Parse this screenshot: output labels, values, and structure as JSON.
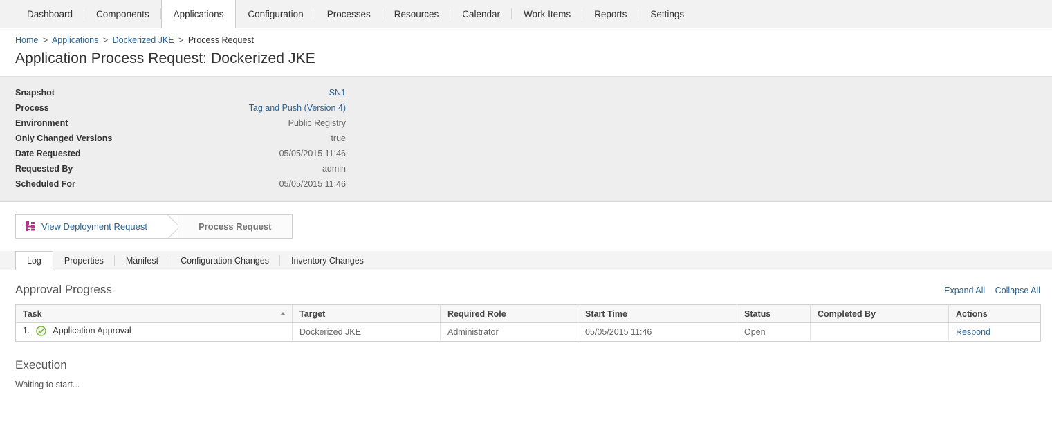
{
  "topnav": {
    "items": [
      {
        "label": "Dashboard",
        "active": false
      },
      {
        "label": "Components",
        "active": false
      },
      {
        "label": "Applications",
        "active": true
      },
      {
        "label": "Configuration",
        "active": false
      },
      {
        "label": "Processes",
        "active": false
      },
      {
        "label": "Resources",
        "active": false
      },
      {
        "label": "Calendar",
        "active": false
      },
      {
        "label": "Work Items",
        "active": false
      },
      {
        "label": "Reports",
        "active": false
      },
      {
        "label": "Settings",
        "active": false
      }
    ]
  },
  "breadcrumb": {
    "items": [
      {
        "label": "Home",
        "link": true
      },
      {
        "label": "Applications",
        "link": true
      },
      {
        "label": "Dockerized JKE",
        "link": true
      },
      {
        "label": "Process Request",
        "link": false
      }
    ],
    "separator": ">"
  },
  "page": {
    "title": "Application Process Request: Dockerized JKE"
  },
  "details": [
    {
      "label": "Snapshot",
      "value": "SN1",
      "link": true
    },
    {
      "label": "Process",
      "value": "Tag and Push (Version 4)",
      "link": true
    },
    {
      "label": "Environment",
      "value": "Public Registry",
      "link": false
    },
    {
      "label": "Only Changed Versions",
      "value": "true",
      "link": false
    },
    {
      "label": "Date Requested",
      "value": "05/05/2015 11:46",
      "link": false
    },
    {
      "label": "Requested By",
      "value": "admin",
      "link": false
    },
    {
      "label": "Scheduled For",
      "value": "05/05/2015 11:46",
      "link": false
    }
  ],
  "segmented": {
    "first_label": "View Deployment Request",
    "first_icon": "tree-branch-icon",
    "second_label": "Process Request"
  },
  "subtabs": {
    "items": [
      {
        "label": "Log",
        "active": true
      },
      {
        "label": "Properties",
        "active": false
      },
      {
        "label": "Manifest",
        "active": false
      },
      {
        "label": "Configuration Changes",
        "active": false
      },
      {
        "label": "Inventory Changes",
        "active": false
      }
    ]
  },
  "approval": {
    "title": "Approval Progress",
    "expand_all": "Expand All",
    "collapse_all": "Collapse All",
    "columns": [
      "Task",
      "Target",
      "Required Role",
      "Start Time",
      "Status",
      "Completed By",
      "Actions"
    ],
    "sorted_column": "Task",
    "sort_direction": "asc",
    "rows": [
      {
        "number": "1.",
        "icon": "green-check-circle-icon",
        "task": "Application Approval",
        "target": "Dockerized JKE",
        "required_role": "Administrator",
        "start_time": "05/05/2015 11:46",
        "status": "Open",
        "completed_by": "",
        "action": "Respond"
      }
    ]
  },
  "execution": {
    "title": "Execution",
    "message": "Waiting to start..."
  },
  "colors": {
    "link": "#2a6496",
    "status_open_bg": "#f5f3cd",
    "accent_magenta": "#bf2f8f",
    "check_green": "#7cb342",
    "panel_bg": "#eeeeee"
  }
}
